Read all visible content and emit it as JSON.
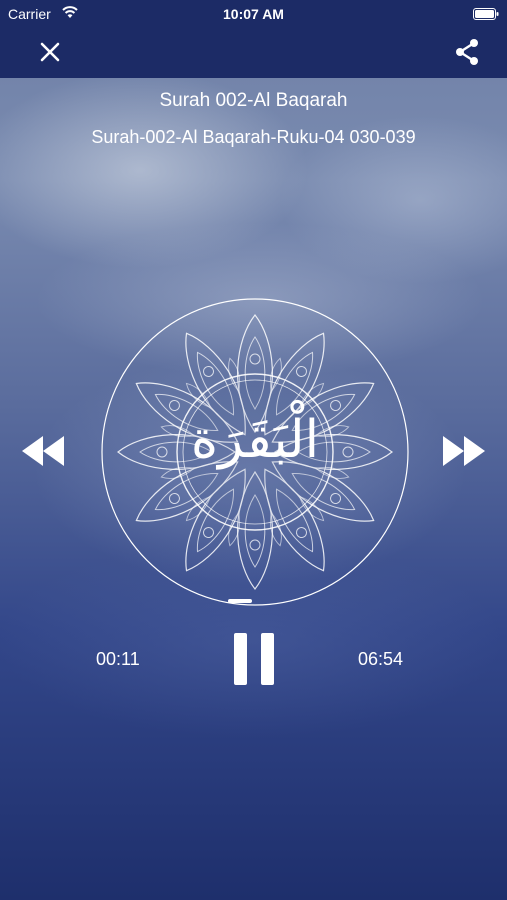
{
  "status_bar": {
    "carrier": "Carrier",
    "time": "10:07 AM",
    "icons": [
      "wifi-icon",
      "battery-icon"
    ]
  },
  "nav": {
    "close_icon": "close-icon",
    "share_icon": "share-icon"
  },
  "track": {
    "title": "Surah 002-Al Baqarah",
    "subtitle": "Surah-002-Al Baqarah-Ruku-04 030-039",
    "artwork_text": "الْبَقَرَة"
  },
  "player": {
    "elapsed": "00:11",
    "total": "06:54",
    "progress_fraction": 0.027,
    "controls": [
      "rewind-icon",
      "pause-icon",
      "fast-forward-icon"
    ]
  },
  "colors": {
    "bar_background": "#1c2b66",
    "accent": "#ffffff"
  }
}
